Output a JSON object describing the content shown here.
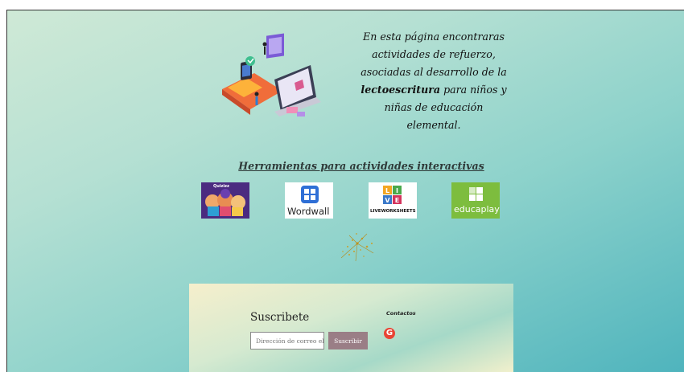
{
  "intro": {
    "line1": "En esta página encontraras",
    "line2": "actividades de refuerzo,",
    "line3": "asociadas al desarrollo de la",
    "bold_word": "lectoescritura",
    "line4_rest": " para niños y",
    "line5": "niñas de educación",
    "line6": "elemental."
  },
  "section_title": "Herramientas para actividades interactivas",
  "tools": [
    {
      "name": "Quizizz",
      "label": "Quizizz",
      "color": "#4b2b80"
    },
    {
      "name": "Wordwall",
      "label": "Wordwall",
      "color": "#ffffff"
    },
    {
      "name": "Liveworksheets",
      "label": "LIVEWORKSHEETS",
      "color": "#ffffff"
    },
    {
      "name": "Educaplay",
      "label": "educaplay",
      "color": "#7dbd3e"
    }
  ],
  "footer": {
    "subscribe_title": "Suscribete",
    "email_placeholder": "Dirección de correo ele",
    "subscribe_button": "Suscribir",
    "contact_title": "Contactos",
    "contact_icon": "google-icon"
  }
}
